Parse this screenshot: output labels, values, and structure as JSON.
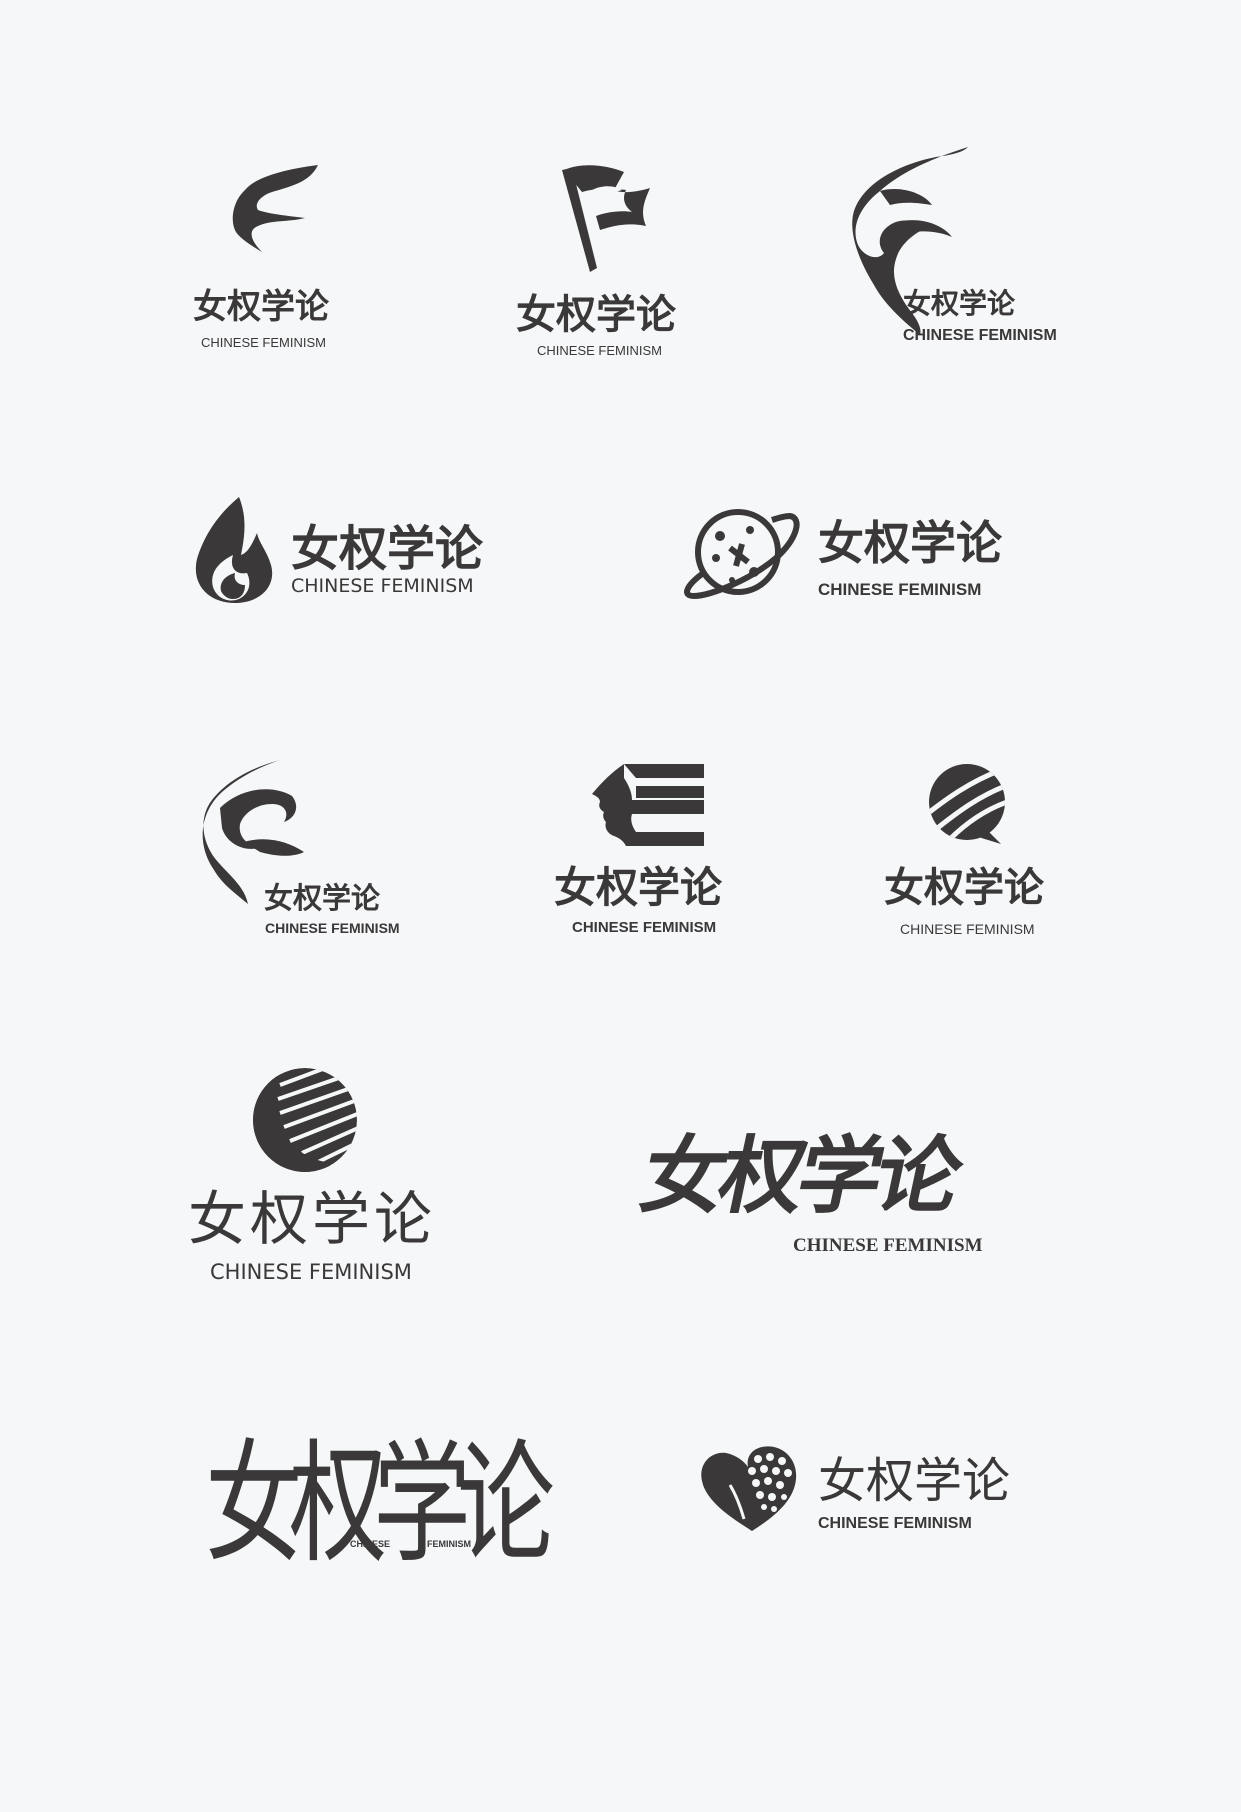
{
  "background": "#f5f7f8",
  "ink": "#3a3838",
  "logos": [
    {
      "cn": "女权学论",
      "en": "CHINESE FEMINISM",
      "mark": "flame-f-icon"
    },
    {
      "cn": "女权学论",
      "en": "CHINESE FEMINISM",
      "mark": "flag-icon"
    },
    {
      "cn": "女权学论",
      "en": "CHINESE FEMINISM",
      "mark": "leaf-swirl-icon"
    },
    {
      "cn": "女权学论",
      "en": "CHINESE FEMINISM",
      "mark": "fire-icon"
    },
    {
      "cn": "女权学论",
      "en": "CHINESE FEMINISM",
      "mark": "planet-icon"
    },
    {
      "cn": "女权学论",
      "en": "CHINESE FEMINISM",
      "mark": "leaf-swirl-icon"
    },
    {
      "cn": "女权学论",
      "en": "CHINESE FEMINISM",
      "mark": "profile-e-icon"
    },
    {
      "cn": "女权学论",
      "en": "CHINESE FEMINISM",
      "mark": "striped-ball-icon"
    },
    {
      "cn": "女权学论",
      "en": "CHINESE FEMINISM",
      "mark": "striped-moon-icon"
    },
    {
      "cn": "女权学论",
      "en": "CHINESE FEMINISM",
      "mark": "brush-lettering"
    },
    {
      "cn": "女权学论",
      "en_left": "CHINESE",
      "en_right": "FEMINISM",
      "mark": "calligraphy-lettering"
    },
    {
      "cn": "女权学论",
      "en": "CHINESE FEMINISM",
      "mark": "heart-flower-icon"
    }
  ]
}
